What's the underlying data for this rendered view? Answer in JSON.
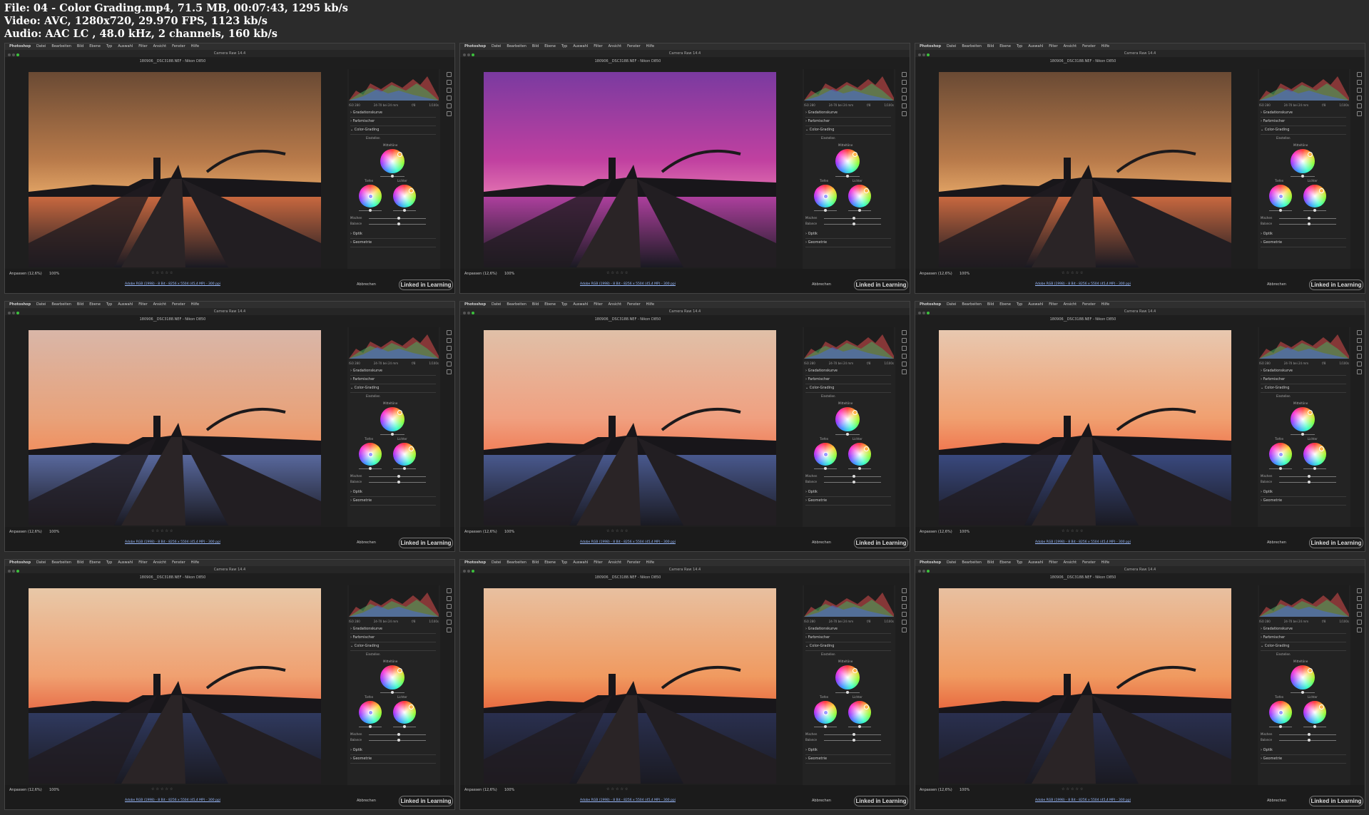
{
  "header": {
    "line1": "File: 04 - Color Grading.mp4, 71.5 MB, 00:07:43, 1295 kb/s",
    "line2": "Video: AVC, 1280x720, 29.970 FPS, 1123 kb/s",
    "line3": "Audio: AAC LC , 48.0 kHz, 2 channels, 160 kb/s"
  },
  "menu": {
    "app": "Photoshop",
    "items": [
      "Datei",
      "Bearbeiten",
      "Bild",
      "Ebene",
      "Typ",
      "Auswahl",
      "Filter",
      "Ansicht",
      "Fenster",
      "Hilfe"
    ]
  },
  "window_title": "Camera Raw 14.4",
  "file_name": "180906__DSC3188.NEF - Nikon D850",
  "panel": {
    "meta": [
      "ISO 280",
      "24-70 bei 24 mm",
      "f/8",
      "1/100s"
    ],
    "sections": [
      "Gradationskurve",
      "Farbmischer",
      "Color-Grading",
      "Optik",
      "Geometrie"
    ],
    "adjust_label": "Einstellen",
    "wheel_labels": {
      "mid": "Mitteltöne",
      "shadows": "Tiefen",
      "highlights": "Lichter"
    },
    "slider_labels": {
      "blend": "Mischen",
      "balance": "Balance"
    }
  },
  "bottom": {
    "fit": "Anpassen (12,6%)",
    "zoom": "100%",
    "workflow": "Adobe RGB (1998) - 8 Bit - 8256 x 5504 (45,4 MP) - 300 ppi",
    "cancel": "Abbrechen",
    "brand": "Linked in Learning",
    "stars": "☆☆☆☆☆"
  },
  "colors": {
    "accent": "#3cc03c",
    "link": "#9bbcff",
    "background": "#2b2b2b"
  },
  "frames": [
    {
      "sky": [
        "#6a4a34",
        "#b87a4a",
        "#e0a264"
      ],
      "tint": "#cc6a40"
    },
    {
      "sky": [
        "#7a3aa0",
        "#c040a0",
        "#e070b0"
      ],
      "tint": "#b040a0"
    },
    {
      "sky": [
        "#6a4a34",
        "#b87a4a",
        "#e0a264"
      ],
      "tint": "#cc6a40"
    },
    {
      "sky": [
        "#d9b6a8",
        "#e8a27a",
        "#f09060"
      ],
      "tint": "#5a6aa0"
    },
    {
      "sky": [
        "#e0c0a8",
        "#f0a080",
        "#f0805a"
      ],
      "tint": "#4a5a90"
    },
    {
      "sky": [
        "#e8c8b0",
        "#f0a070",
        "#f07850"
      ],
      "tint": "#3a4a80"
    },
    {
      "sky": [
        "#e8c8a8",
        "#f0a070",
        "#e8704a"
      ],
      "tint": "#303a60"
    },
    {
      "sky": [
        "#e8c0a0",
        "#f09a60",
        "#e86a40"
      ],
      "tint": "#2a3050"
    },
    {
      "sky": [
        "#e8c0a0",
        "#f09a60",
        "#e86a40"
      ],
      "tint": "#2a3050"
    }
  ]
}
